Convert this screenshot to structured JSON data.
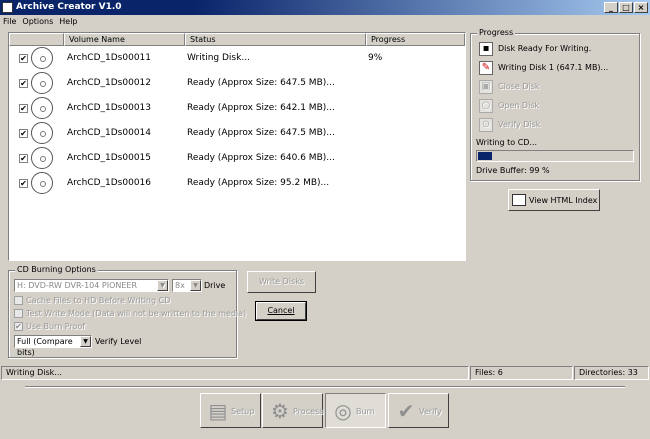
{
  "window": {
    "title": "Archive Creator V1.0",
    "minimize": "_",
    "maximize": "□",
    "close": "×"
  },
  "menu": {
    "file": "File",
    "options": "Options",
    "help": "Help"
  },
  "list": {
    "columns": {
      "volume": "Volume Name",
      "status": "Status",
      "progress": "Progress"
    },
    "rows": [
      {
        "checked": true,
        "name": "ArchCD_1Ds00011",
        "status": "Writing Disk...",
        "progress": "9%"
      },
      {
        "checked": true,
        "name": "ArchCD_1Ds00012",
        "status": "Ready (Approx Size: 647.5 MB)...",
        "progress": ""
      },
      {
        "checked": true,
        "name": "ArchCD_1Ds00013",
        "status": "Ready (Approx Size: 642.1 MB)...",
        "progress": ""
      },
      {
        "checked": true,
        "name": "ArchCD_1Ds00014",
        "status": "Ready (Approx Size: 647.5 MB)...",
        "progress": ""
      },
      {
        "checked": true,
        "name": "ArchCD_1Ds00015",
        "status": "Ready (Approx Size: 640.6 MB)...",
        "progress": ""
      },
      {
        "checked": true,
        "name": "ArchCD_1Ds00016",
        "status": "Ready (Approx Size: 95.2 MB)...",
        "progress": ""
      }
    ]
  },
  "progress": {
    "title": "Progress",
    "steps": {
      "ready": "Disk Ready For Writing.",
      "writing": "Writing Disk 1 (647.1 MB)...",
      "close": "Close Disk",
      "open": "Open Disk",
      "verify": "Verify Disk"
    },
    "writing_label": "Writing to CD...",
    "writing_fraction": 0.09,
    "buffer_label": "Drive Buffer: 99 %",
    "accent": "#0a246a"
  },
  "view_index_button": "View HTML Index",
  "burn_options": {
    "title": "CD Burning Options",
    "drive_value": "H: DVD-RW  DVR-104  PIONEER",
    "speed_value": "8x",
    "drive_label": "Drive",
    "cache_files": "Cache Files to HD Before Writing CD",
    "test_write": "Test Write Mode (Data will not be written to the media)",
    "burn_proof": "Use Burn Proof",
    "verify_value": "Full (Compare bits)",
    "verify_label": "Verify Level"
  },
  "write_disks_button": "Write Disks",
  "cancel_button": "Cancel",
  "statusbar": {
    "message": "Writing Disk...",
    "files": "Files: 6",
    "directories": "Directories: 33"
  },
  "nav": {
    "setup": "Setup",
    "process": "Process",
    "burn": "Burn",
    "verify": "Verify"
  },
  "icons": {
    "check": "✔",
    "writing": "✎"
  }
}
